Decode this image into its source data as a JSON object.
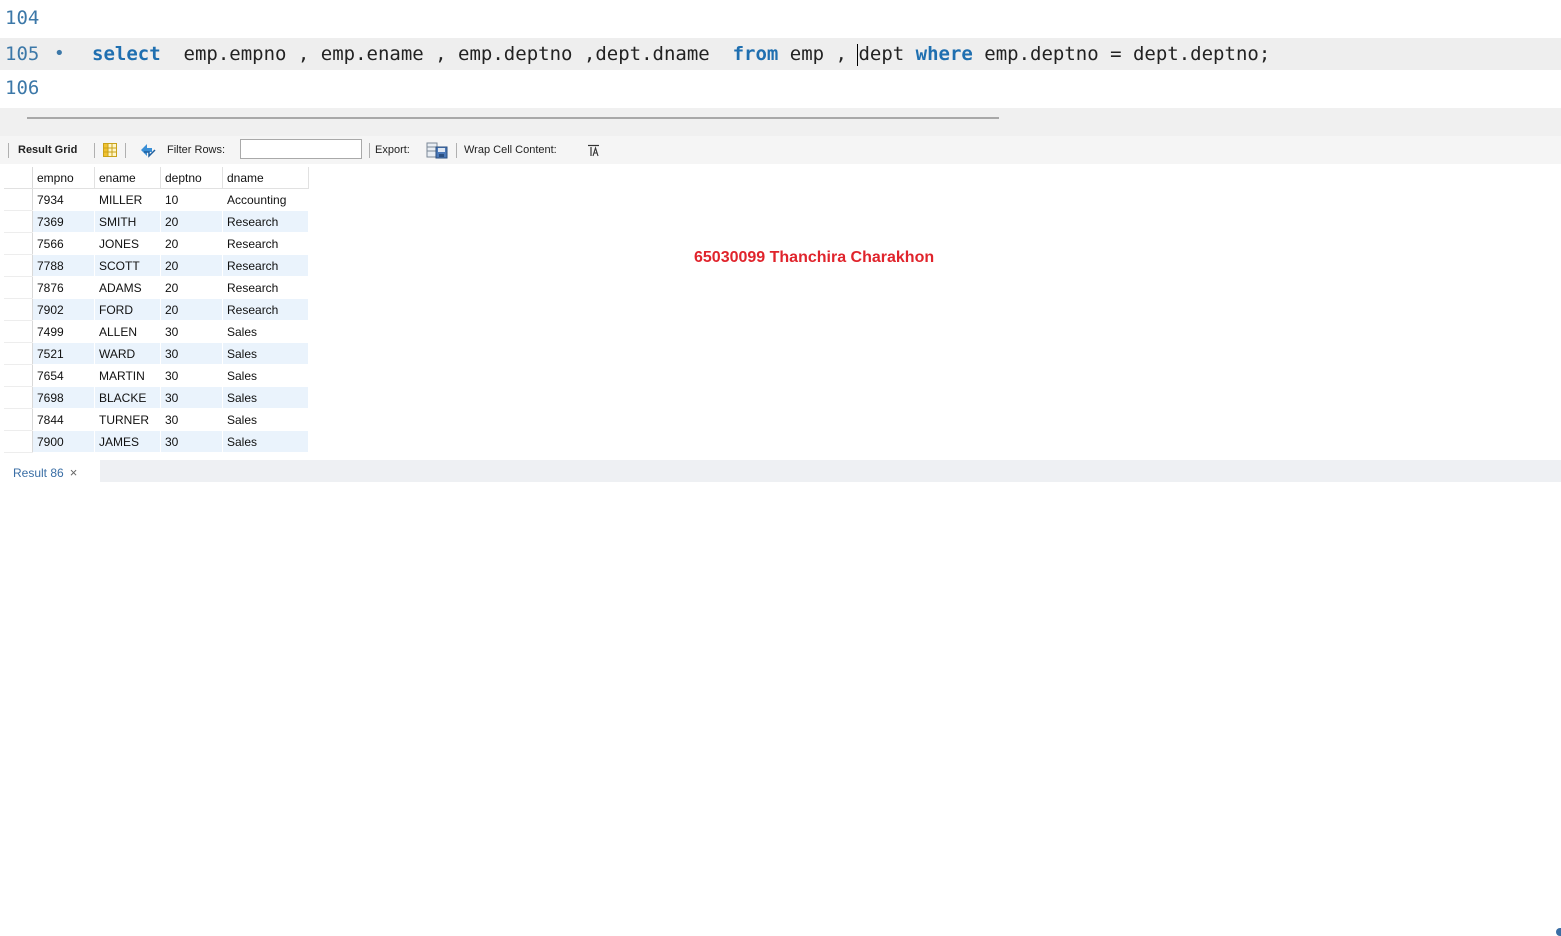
{
  "editor": {
    "lines": [
      {
        "number": "104",
        "text": ""
      },
      {
        "number": "105",
        "marker": "•",
        "current": true
      },
      {
        "number": "106",
        "text": ""
      }
    ],
    "sql": {
      "kw_select": "select",
      "part1": "  emp.empno , emp.ename , emp.deptno ,dept.dname  ",
      "kw_from": "from",
      "part2": " emp , ",
      "part3": "dept ",
      "kw_where": "where",
      "part4": " emp.deptno = dept.deptno;"
    }
  },
  "toolbar": {
    "result_grid_label": "Result Grid",
    "filter_label": "Filter Rows:",
    "filter_value": "",
    "export_label": "Export:",
    "wrap_label": "Wrap Cell Content:"
  },
  "grid": {
    "columns": [
      "empno",
      "ename",
      "deptno",
      "dname"
    ],
    "rows": [
      [
        "7934",
        "MILLER",
        "10",
        "Accounting"
      ],
      [
        "7369",
        "SMITH",
        "20",
        "Research"
      ],
      [
        "7566",
        "JONES",
        "20",
        "Research"
      ],
      [
        "7788",
        "SCOTT",
        "20",
        "Research"
      ],
      [
        "7876",
        "ADAMS",
        "20",
        "Research"
      ],
      [
        "7902",
        "FORD",
        "20",
        "Research"
      ],
      [
        "7499",
        "ALLEN",
        "30",
        "Sales"
      ],
      [
        "7521",
        "WARD",
        "30",
        "Sales"
      ],
      [
        "7654",
        "MARTIN",
        "30",
        "Sales"
      ],
      [
        "7698",
        "BLACKE",
        "30",
        "Sales"
      ],
      [
        "7844",
        "TURNER",
        "30",
        "Sales"
      ],
      [
        "7900",
        "JAMES",
        "30",
        "Sales"
      ]
    ]
  },
  "watermark": "65030099 Thanchira Charakhon",
  "result_tab": {
    "label": "Result 86",
    "close_glyph": "×"
  },
  "colors": {
    "keyword": "#1f6fb0",
    "line_number": "#3c78a8",
    "watermark": "#e0242c",
    "row_stripe": "#eaf3fc"
  }
}
